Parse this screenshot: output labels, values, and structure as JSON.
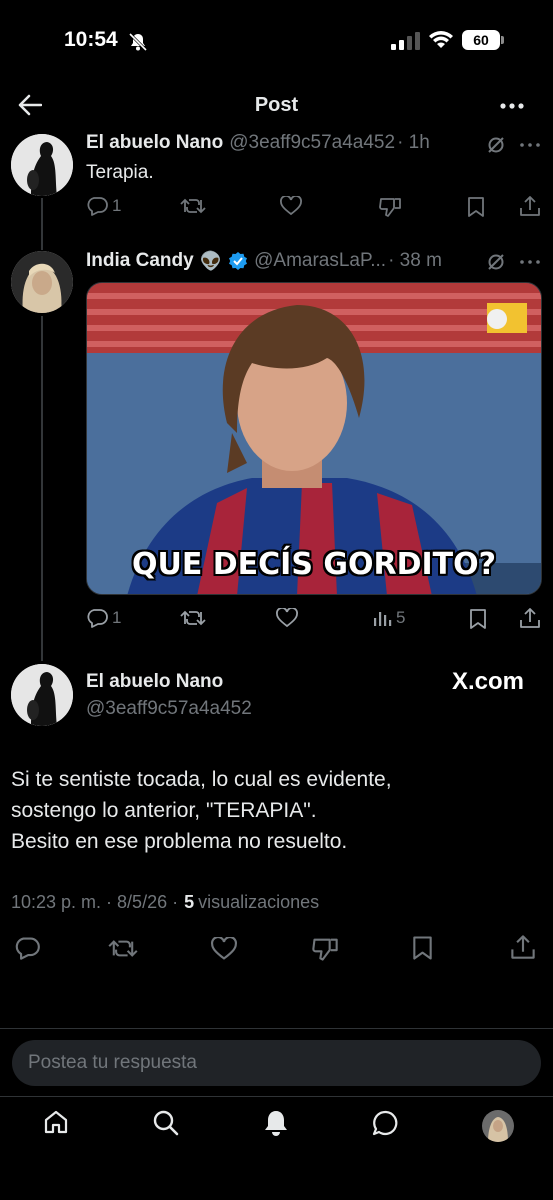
{
  "status_bar": {
    "time": "10:54",
    "battery": "60"
  },
  "header": {
    "title": "Post"
  },
  "tweet1": {
    "name": "El abuelo Nano",
    "handle": "@3eaff9c57a4a452",
    "time": "· 1h",
    "text": "Terapia.",
    "replies": "1"
  },
  "tweet2": {
    "name": "India Candy",
    "emoji": "👽",
    "handle": "@AmarasLaP...",
    "time": "· 38 m",
    "media_caption": "QUE DECÍS GORDITO?",
    "replies": "1",
    "views": "5"
  },
  "main": {
    "name": "El abuelo Nano",
    "handle": "@3eaff9c57a4a452",
    "watermark": "X.com",
    "line1": "Si te sentiste tocada, lo cual es evidente,",
    "line2": "sostengo lo anterior, \"TERAPIA\".",
    "line3": "Besito en ese problema no resuelto.",
    "timestamp": "10:23 p. m. · 8/5/26 ·",
    "views_count": "5",
    "views_label": "visualizaciones"
  },
  "reply": {
    "placeholder": "Postea tu respuesta"
  },
  "colors": {
    "background": "#000000",
    "text": "#e7e9ea",
    "muted": "#71767b",
    "verified": "#1d9bf0",
    "divider": "#2f3336"
  },
  "icons": [
    "back-arrow-icon",
    "more-icon",
    "bell-off-icon",
    "signal-icon",
    "wifi-icon",
    "reply-icon",
    "retweet-icon",
    "like-icon",
    "dislike-icon",
    "bookmark-icon",
    "share-icon",
    "views-icon",
    "verified-icon",
    "grok-icon",
    "home-icon",
    "search-icon",
    "notifications-icon",
    "messages-icon"
  ]
}
